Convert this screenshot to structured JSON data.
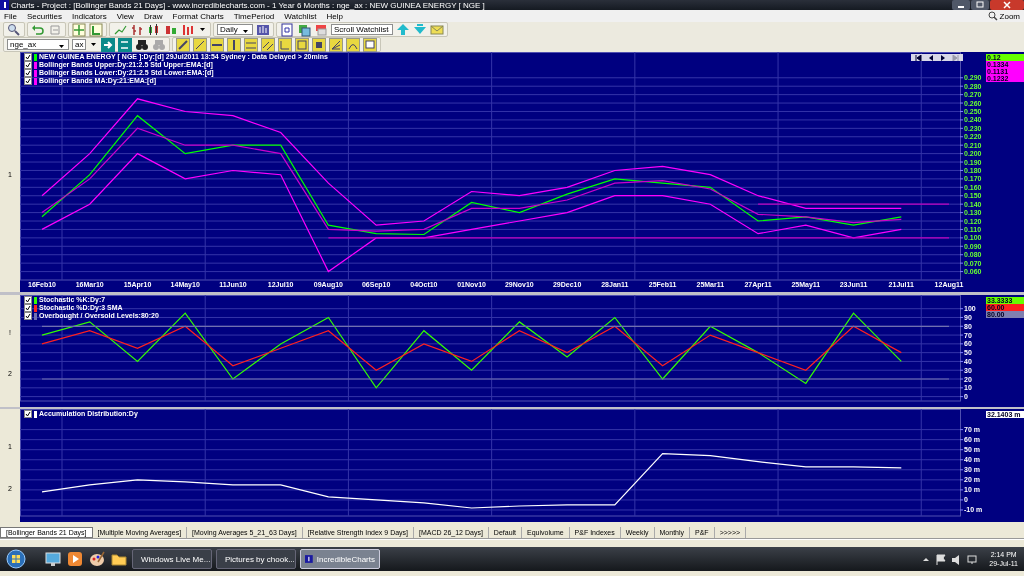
{
  "window": {
    "title": "Charts - Project : [Bollinger Bands 21 Days] - www.incrediblecharts.com - 1 Year 6 Months : nge_ax : NEW GUINEA ENERGY  [ NGE ]"
  },
  "menu": [
    "File",
    "Securities",
    "Indicators",
    "View",
    "Draw",
    "Format Charts",
    "TimePeriod",
    "Watchlist",
    "Help"
  ],
  "zoom_label": "Zoom",
  "toolbar": {
    "period": "Daily",
    "watchlist": "Scroll Watchlist",
    "symbol": "nge_ax",
    "exchange": "ax"
  },
  "panels": [
    {
      "gutter": [
        "1"
      ],
      "legend": [
        {
          "label": "NEW GUINEA ENERGY [ NGE ]:Dy:[d]  29Jul2011 13:54 Sydney : Data Delayed > 20mins",
          "checked": true,
          "color": "#00ff00"
        },
        {
          "label": "Bollinger Bands Upper:Dy:21:2.5 Std Upper:EMA:[d]",
          "checked": true,
          "color": "#ff00ff"
        },
        {
          "label": "Bollinger Bands Lower:Dy:21:2.5 Std Lower:EMA:[d]",
          "checked": true,
          "color": "#ff00ff"
        },
        {
          "label": "Bollinger Bands MA:Dy:21:EMA:[d]",
          "checked": true,
          "color": "#ff00ff"
        }
      ],
      "readouts": [
        {
          "value": "0.12",
          "color": "#66ff00"
        },
        {
          "value": "0.1334",
          "color": "#ff00ff"
        },
        {
          "value": "0.1131",
          "color": "#ff00ff"
        },
        {
          "value": "0.1232",
          "color": "#ff00ff"
        }
      ],
      "chart_data": {
        "type": "line",
        "categories": [
          "16Feb10",
          "16Mar10",
          "15Apr10",
          "14May10",
          "11Jun10",
          "12Jul10",
          "09Aug10",
          "06Sep10",
          "04Oct10",
          "01Nov10",
          "29Nov10",
          "29Dec10",
          "28Jan11",
          "25Feb11",
          "25Mar11",
          "27Apr11",
          "25May11",
          "23Jun11",
          "21Jul11",
          "12Aug11"
        ],
        "ylim": [
          0.05,
          0.32
        ],
        "grid": true,
        "yticks": [
          {
            "value": 0.29,
            "label": "0.290"
          },
          {
            "value": 0.28,
            "label": "0.280"
          },
          {
            "value": 0.27,
            "label": "0.270"
          },
          {
            "value": 0.26,
            "label": "0.260"
          },
          {
            "value": 0.25,
            "label": "0.250"
          },
          {
            "value": 0.24,
            "label": "0.240"
          },
          {
            "value": 0.23,
            "label": "0.230"
          },
          {
            "value": 0.22,
            "label": "0.220"
          },
          {
            "value": 0.21,
            "label": "0.210"
          },
          {
            "value": 0.2,
            "label": "0.200"
          },
          {
            "value": 0.19,
            "label": "0.190"
          },
          {
            "value": 0.18,
            "label": "0.180"
          },
          {
            "value": 0.17,
            "label": "0.170"
          },
          {
            "value": 0.16,
            "label": "0.160"
          },
          {
            "value": 0.15,
            "label": "0.150"
          },
          {
            "value": 0.14,
            "label": "0.140"
          },
          {
            "value": 0.13,
            "label": "0.130"
          },
          {
            "value": 0.12,
            "label": "0.120"
          },
          {
            "value": 0.11,
            "label": "0.110"
          },
          {
            "value": 0.1,
            "label": "0.100"
          },
          {
            "value": 0.09,
            "label": "0.090"
          },
          {
            "value": 0.08,
            "label": "0.080"
          },
          {
            "value": 0.07,
            "label": "0.070"
          },
          {
            "value": 0.06,
            "label": "0.060"
          }
        ],
        "series": [
          {
            "color": "#00ff00",
            "values": [
              0.125,
              0.175,
              0.245,
              0.2,
              0.21,
              0.21,
              0.115,
              0.105,
              0.104,
              0.142,
              0.13,
              0.152,
              0.17,
              0.165,
              0.16,
              0.12,
              0.125,
              0.115,
              0.125,
              null
            ]
          },
          {
            "color": "#ff00ff",
            "values": [
              0.15,
              0.2,
              0.265,
              0.25,
              0.245,
              0.225,
              0.165,
              0.115,
              0.12,
              0.155,
              0.15,
              0.16,
              0.18,
              0.185,
              0.175,
              0.15,
              0.135,
              0.135,
              0.135,
              null
            ]
          },
          {
            "color": "#ff00ff",
            "values": [
              0.11,
              0.14,
              0.2,
              0.17,
              0.18,
              0.175,
              0.06,
              0.1,
              0.1,
              0.11,
              0.12,
              0.13,
              0.15,
              0.15,
              0.14,
              0.105,
              0.115,
              0.1,
              0.11,
              null
            ]
          },
          {
            "color": "#cc00cc",
            "values": [
              0.13,
              0.17,
              0.23,
              0.21,
              0.21,
              0.2,
              0.11,
              0.108,
              0.11,
              0.135,
              0.135,
              0.145,
              0.165,
              0.168,
              0.158,
              0.128,
              0.125,
              0.118,
              0.122,
              null
            ]
          },
          {
            "color": "#c000c0",
            "values": [
              null,
              null,
              null,
              null,
              null,
              null,
              null,
              null,
              null,
              null,
              null,
              null,
              null,
              null,
              null,
              0.14,
              0.14,
              0.14,
              0.14,
              0.14
            ]
          },
          {
            "color": "#c000c0",
            "values": [
              null,
              null,
              null,
              null,
              null,
              null,
              0.1,
              0.1,
              0.1,
              0.1,
              0.1,
              0.1,
              0.1,
              0.1,
              0.1,
              0.1,
              0.1,
              0.1,
              0.1,
              0.1
            ]
          }
        ]
      }
    },
    {
      "gutter": [
        "!",
        "2"
      ],
      "legend": [
        {
          "label": "Stochastic %K:Dy:7",
          "checked": true,
          "color": "#33ff00"
        },
        {
          "label": "Stochastic %D:Dy:3 SMA",
          "checked": true,
          "color": "#ff2020"
        },
        {
          "label": "Overbought / Oversold Levels:80:20",
          "checked": true,
          "color": "#7070b0"
        }
      ],
      "readouts": [
        {
          "value": "33.3333",
          "color": "#66ff00"
        },
        {
          "value": "60.00",
          "color": "#ff2020"
        },
        {
          "value": "80.00",
          "color": "#8080b0"
        }
      ],
      "chart_data": {
        "type": "line",
        "ylim": [
          -5,
          115
        ],
        "grid": true,
        "yticks": [
          100,
          90,
          80,
          70,
          60,
          50,
          40,
          30,
          20,
          10,
          0
        ],
        "series": [
          {
            "color": "#33ff00",
            "values": [
              70,
              85,
              40,
              95,
              20,
              60,
              90,
              10,
              75,
              30,
              85,
              45,
              90,
              20,
              80,
              50,
              15,
              95,
              40,
              null
            ]
          },
          {
            "color": "#ff2020",
            "values": [
              60,
              75,
              55,
              80,
              35,
              55,
              75,
              30,
              60,
              40,
              75,
              50,
              80,
              35,
              70,
              50,
              30,
              80,
              50,
              null
            ]
          },
          {
            "color": "#7070b0",
            "values": [
              80,
              80,
              80,
              80,
              80,
              80,
              80,
              80,
              80,
              80,
              80,
              80,
              80,
              80,
              80,
              80,
              80,
              80,
              80,
              80
            ]
          },
          {
            "color": "#7070b0",
            "values": [
              20,
              20,
              20,
              20,
              20,
              20,
              20,
              20,
              20,
              20,
              20,
              20,
              20,
              20,
              20,
              20,
              20,
              20,
              20,
              20
            ]
          }
        ]
      }
    },
    {
      "gutter": [
        "1",
        "2"
      ],
      "legend": [
        {
          "label": "Accumulation Distribution:Dy",
          "checked": true,
          "color": "#ffffff"
        }
      ],
      "readouts": [
        {
          "value": "32.1403 m",
          "color": "#ffffff"
        }
      ],
      "chart_data": {
        "type": "line",
        "ylim": [
          -16,
          90
        ],
        "grid": true,
        "yticks": [
          {
            "value": 70,
            "label": "70 m"
          },
          {
            "value": 60,
            "label": "60 m"
          },
          {
            "value": 50,
            "label": "50 m"
          },
          {
            "value": 40,
            "label": "40 m"
          },
          {
            "value": 30,
            "label": "30 m"
          },
          {
            "value": 20,
            "label": "20 m"
          },
          {
            "value": 10,
            "label": "10 m"
          },
          {
            "value": 0,
            "label": "0"
          },
          {
            "value": -10,
            "label": "-10 m"
          }
        ],
        "series": [
          {
            "color": "#ffffff",
            "values": [
              8,
              15,
              20,
              18,
              15,
              15,
              3,
              0,
              -3,
              -8,
              -6,
              -5,
              -5,
              46,
              44,
              38,
              33,
              33,
              32,
              null
            ]
          }
        ]
      }
    }
  ],
  "tabs": [
    {
      "label": "[Bollinger Bands 21 Days]",
      "selected": true
    },
    {
      "label": "[Multiple Moving Averages]",
      "selected": false
    },
    {
      "label": "[Moving Averages 5_21_63 Days]",
      "selected": false
    },
    {
      "label": "[Relative Strength Index 9 Days]",
      "selected": false
    },
    {
      "label": "[MACD 26_12 Days]",
      "selected": false
    },
    {
      "label": "Default",
      "selected": false
    },
    {
      "label": "Equivolume",
      "selected": false
    },
    {
      "label": "P&F Indexes",
      "selected": false
    },
    {
      "label": "Weekly",
      "selected": false
    },
    {
      "label": "Monthly",
      "selected": false
    },
    {
      "label": "P&F",
      "selected": false
    },
    {
      "label": ">>>>>",
      "selected": false
    }
  ],
  "taskbar": {
    "tasks": [
      {
        "label": "Windows Live Me...",
        "selected": false
      },
      {
        "label": "Pictures by chook...",
        "selected": false
      },
      {
        "label": "IncredibleCharts",
        "selected": true
      }
    ],
    "time": "2:14 PM",
    "date": "29-Jul-11"
  }
}
